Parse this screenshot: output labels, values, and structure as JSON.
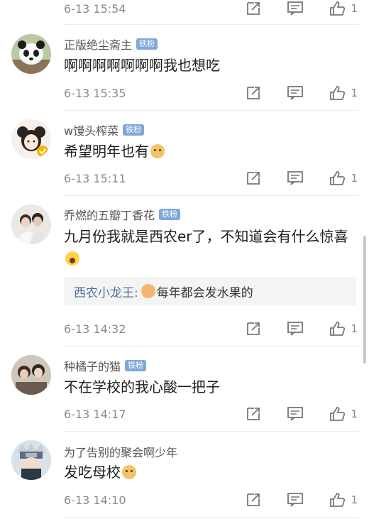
{
  "badge_label": "铁粉",
  "top_row": {
    "time": "6-13 15:54",
    "likes": "1"
  },
  "comments": [
    {
      "username": "正版绝尘斋主",
      "has_badge": true,
      "text": "啊啊啊啊啊啊啊我也想吃",
      "emoji": "",
      "time": "6-13 15:35",
      "likes": "1",
      "avatar_icon": "panda-avatar"
    },
    {
      "username": "w馒头榨菜",
      "has_badge": true,
      "text": "希望明年也有",
      "emoji": "doge",
      "time": "6-13 15:11",
      "likes": "1",
      "avatar_icon": "girl-avatar"
    },
    {
      "username": "乔燃的五瓣丁香花",
      "has_badge": true,
      "text": "九月份我就是西农er了，不知道会有什么惊喜",
      "emoji": "scream",
      "time": "6-13 14:32",
      "likes": "1",
      "avatar_icon": "couple-avatar",
      "reply": {
        "user": "西农小龙王:",
        "text": "每年都会发水果的",
        "emoji": "cat"
      }
    },
    {
      "username": "种橘子的猫",
      "has_badge": true,
      "text": "不在学校的我心酸一把子",
      "emoji": "",
      "time": "6-13 14:17",
      "likes": "1",
      "avatar_icon": "photo-avatar"
    },
    {
      "username": "为了告别的聚会啊少年",
      "has_badge": false,
      "text": "发吃母校",
      "emoji": "doge",
      "time": "6-13 14:10",
      "likes": "1",
      "avatar_icon": "ninja-avatar"
    }
  ],
  "colors": {
    "badge": "#7fa8d8",
    "reply_user": "#4e6f9c",
    "meta": "#8a8a8a"
  }
}
